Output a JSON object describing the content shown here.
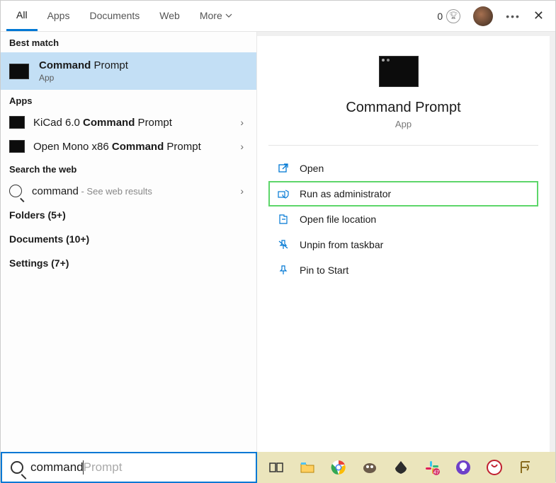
{
  "topbar": {
    "tabs": {
      "all": "All",
      "apps": "Apps",
      "documents": "Documents",
      "web": "Web",
      "more": "More"
    },
    "rewards_count": "0"
  },
  "left": {
    "best_match_header": "Best match",
    "selected": {
      "title_bold": "Command",
      "title_rest": " Prompt",
      "subtitle": "App"
    },
    "apps_header": "Apps",
    "app_results": [
      {
        "prefix": "KiCad 6.0 ",
        "bold": "Command",
        "suffix": " Prompt"
      },
      {
        "prefix": "Open Mono x86 ",
        "bold": "Command",
        "suffix": " Prompt"
      }
    ],
    "web_header": "Search the web",
    "web_result": {
      "term": "command",
      "suffix": " - See web results"
    },
    "categories": {
      "folders": "Folders (5+)",
      "documents": "Documents (10+)",
      "settings": "Settings (7+)"
    }
  },
  "right": {
    "title": "Command Prompt",
    "subtitle": "App",
    "actions": {
      "open": "Open",
      "run_admin": "Run as administrator",
      "open_loc": "Open file location",
      "unpin": "Unpin from taskbar",
      "pin_start": "Pin to Start"
    }
  },
  "search": {
    "value": "command",
    "ghost": "Prompt"
  }
}
